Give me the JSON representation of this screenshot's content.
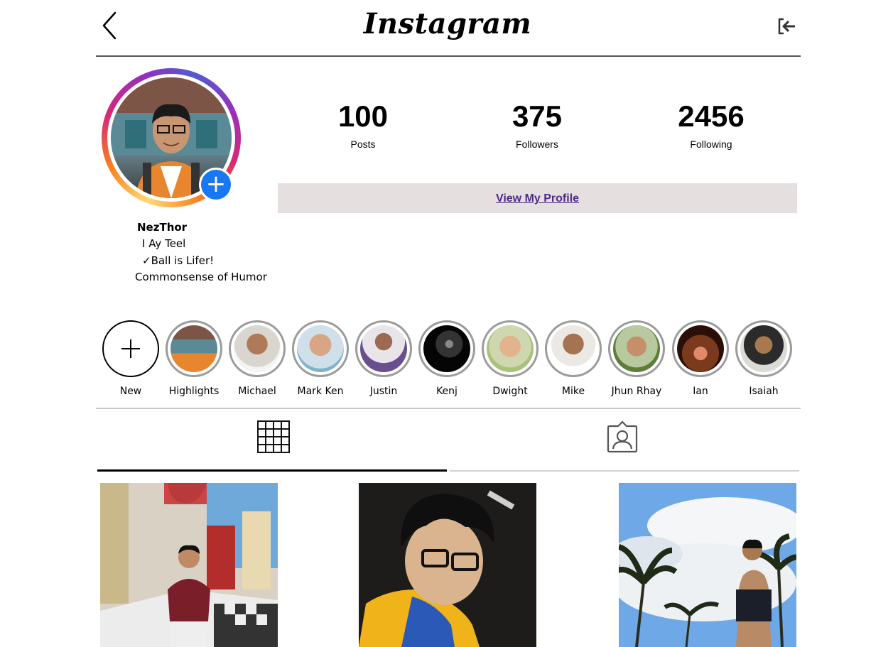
{
  "header": {
    "title": "Instagram",
    "back_icon": "chevron-left-icon",
    "logout_icon": "logout-icon"
  },
  "profile": {
    "username": "NezThor",
    "bio": [
      "I  Ay Teel",
      "✓Ball is Lifer!",
      "Commonsense of Humor"
    ],
    "add_story_icon": "plus-icon",
    "ring_colors": [
      "#feda75",
      "#fa7e1e",
      "#d62976",
      "#962fbf",
      "#4f5bd5"
    ],
    "add_button_color": "#1877f2"
  },
  "stats": [
    {
      "value": "100",
      "label": "Posts"
    },
    {
      "value": "375",
      "label": "Followers"
    },
    {
      "value": "2456",
      "label": "Following"
    }
  ],
  "view_profile": {
    "label": "View My Profile",
    "bg": "#e6dfdf",
    "color": "#4b2b8a"
  },
  "highlights": [
    {
      "label": "New"
    },
    {
      "label": "Highlights"
    },
    {
      "label": "Michael"
    },
    {
      "label": "Mark Ken"
    },
    {
      "label": "Justin"
    },
    {
      "label": "Kenj"
    },
    {
      "label": "Dwight"
    },
    {
      "label": "Mike"
    },
    {
      "label": "Jhun Rhay"
    },
    {
      "label": "Ian"
    },
    {
      "label": "Isaiah"
    }
  ],
  "tabs": [
    {
      "icon": "grid-icon",
      "active": true
    },
    {
      "icon": "tagged-person-icon",
      "active": false
    }
  ]
}
